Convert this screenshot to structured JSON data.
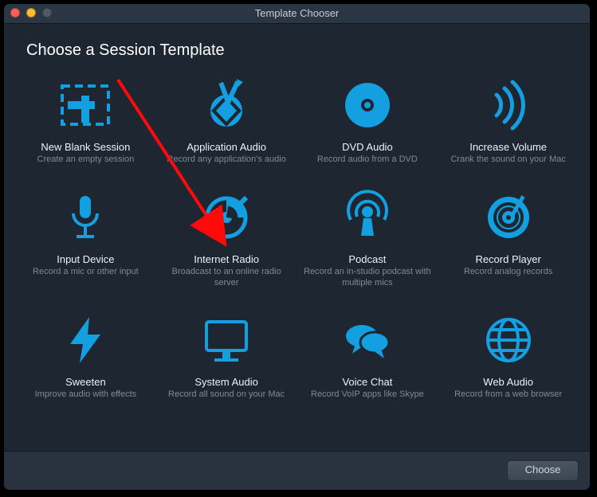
{
  "window": {
    "title": "Template Chooser"
  },
  "heading": "Choose a Session Template",
  "templates": [
    {
      "icon": "new-blank",
      "title": "New Blank Session",
      "desc": "Create an empty session"
    },
    {
      "icon": "application",
      "title": "Application Audio",
      "desc": "Record any application's audio"
    },
    {
      "icon": "dvd",
      "title": "DVD Audio",
      "desc": "Record audio from a DVD"
    },
    {
      "icon": "volume",
      "title": "Increase Volume",
      "desc": "Crank the sound on your Mac"
    },
    {
      "icon": "mic",
      "title": "Input Device",
      "desc": "Record a mic or other input"
    },
    {
      "icon": "radio",
      "title": "Internet Radio",
      "desc": "Broadcast to an online radio server"
    },
    {
      "icon": "podcast",
      "title": "Podcast",
      "desc": "Record an in-studio podcast with multiple mics"
    },
    {
      "icon": "record-player",
      "title": "Record Player",
      "desc": "Record analog records"
    },
    {
      "icon": "sweeten",
      "title": "Sweeten",
      "desc": "Improve audio with effects"
    },
    {
      "icon": "system",
      "title": "System Audio",
      "desc": "Record all sound on your Mac"
    },
    {
      "icon": "voice-chat",
      "title": "Voice Chat",
      "desc": "Record VoIP apps like Skype"
    },
    {
      "icon": "web",
      "title": "Web Audio",
      "desc": "Record from a web browser"
    }
  ],
  "footer": {
    "choose_label": "Choose"
  },
  "accent": "#139fe0"
}
